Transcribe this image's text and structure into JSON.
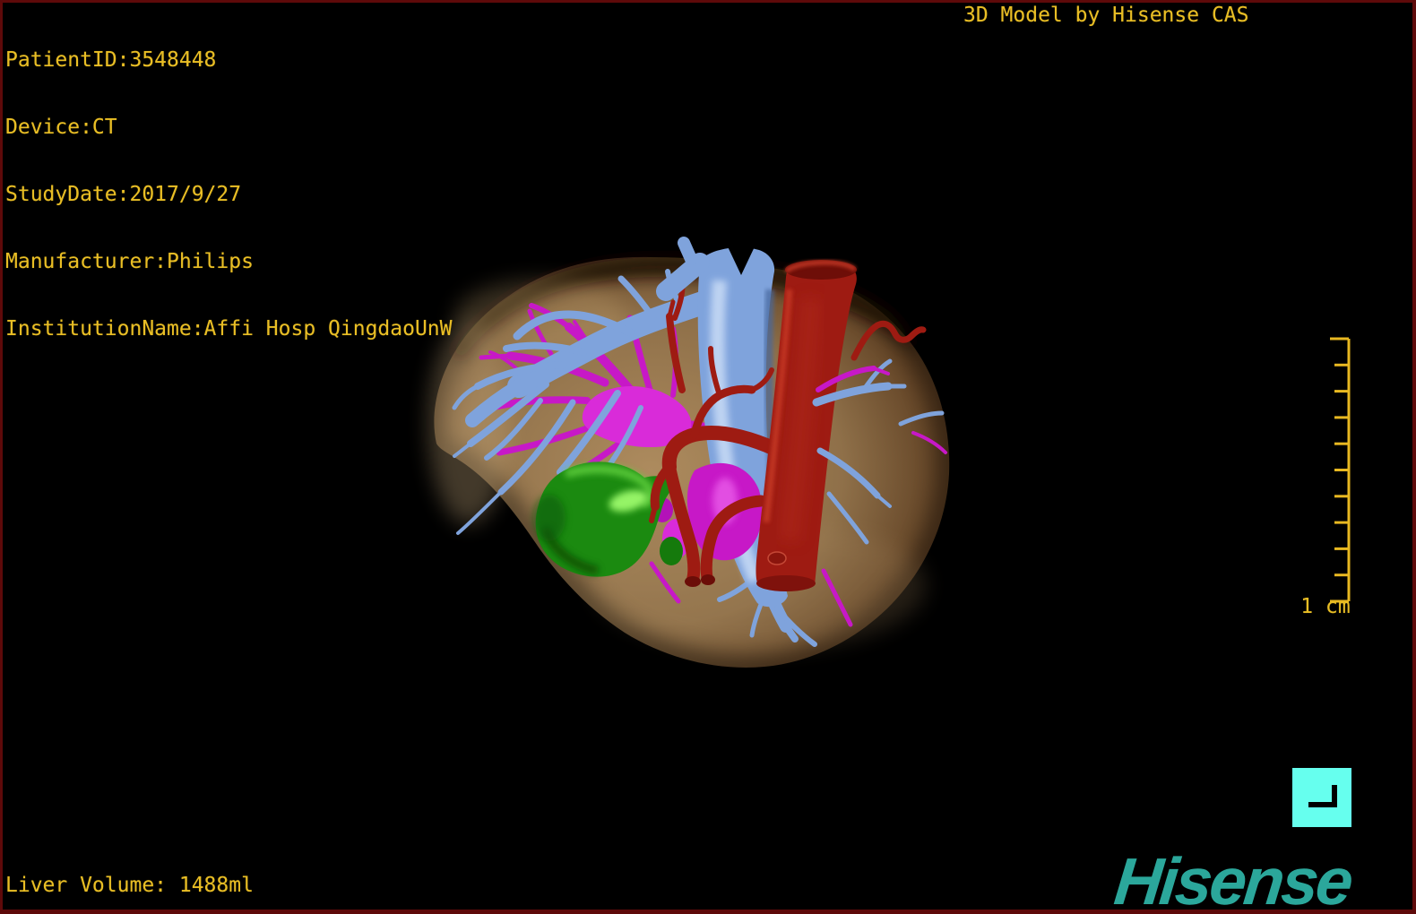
{
  "header": {
    "patient_info": {
      "lines": [
        "PatientID:3548448",
        "Device:CT",
        "StudyDate:2017/9/27",
        "Manufacturer:Philips",
        "InstitutionName:Affi Hosp QingdaoUnW"
      ]
    },
    "title": "3D Model by Hisense CAS"
  },
  "viewport": {
    "description": "3D liver segmentation model",
    "structures": [
      {
        "name": "liver",
        "color": "#96744C"
      },
      {
        "name": "portal-and-hepatic-veins",
        "color": "#7FA3DC"
      },
      {
        "name": "aorta-and-hepatic-artery",
        "color": "#9E1B12"
      },
      {
        "name": "biliary-ducts",
        "color": "#C718C7"
      },
      {
        "name": "gallbladder",
        "color": "#1B8A10"
      }
    ]
  },
  "scale_bar": {
    "label": "1 cm",
    "tick_count": 11
  },
  "footer": {
    "liver_volume": "Liver Volume: 1488ml"
  },
  "branding": {
    "logo_text": "Hisense",
    "icon": "corner-mark-icon"
  },
  "colors": {
    "overlay_text": "#E9BE25",
    "frame_border": "#5E0A0A",
    "background": "#000000",
    "liver": "#96744C",
    "vein_blue": "#7FA3DC",
    "vein_blue_dark": "#46689E",
    "vein_blue_light": "#C9DCF6",
    "artery_red": "#9E1B12",
    "artery_red_dark": "#6E0E08",
    "artery_red_light": "#C83A28",
    "duct_magenta": "#C718C7",
    "gallbladder_green": "#1B8A10",
    "scale_bar_yellow": "#E8B821",
    "logo_teal": "#2BA79B",
    "icon_cyan": "#66FFEE"
  }
}
